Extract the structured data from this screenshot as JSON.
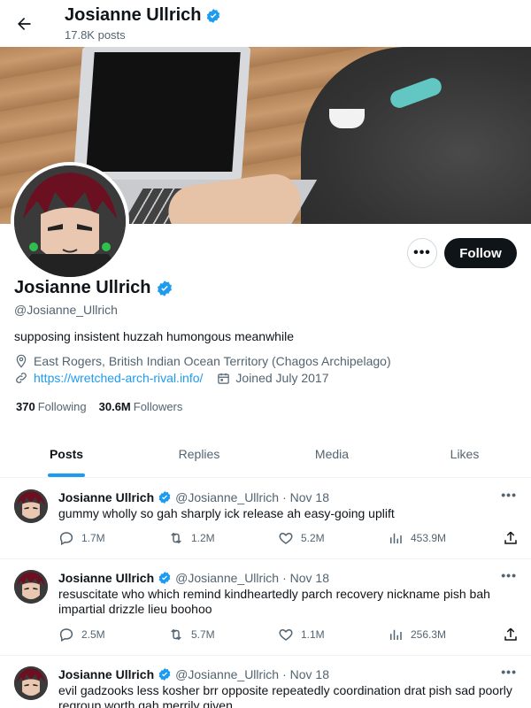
{
  "header": {
    "title": "Josianne Ullrich",
    "post_count": "17.8K posts"
  },
  "profile": {
    "display_name": "Josianne Ullrich",
    "handle": "@Josianne_Ullrich",
    "bio": "supposing insistent huzzah humongous meanwhile",
    "location": "East Rogers, British Indian Ocean Territory (Chagos Archipelago)",
    "url": "https://wretched-arch-rival.info/",
    "joined": "Joined July 2017",
    "following_count": "370",
    "following_label": "Following",
    "followers_count": "30.6M",
    "followers_label": "Followers",
    "follow_button": "Follow",
    "more_button": "•••",
    "verified_color": "#1d9bf0"
  },
  "tabs": [
    {
      "label": "Posts",
      "active": true
    },
    {
      "label": "Replies",
      "active": false
    },
    {
      "label": "Media",
      "active": false
    },
    {
      "label": "Likes",
      "active": false
    }
  ],
  "posts": [
    {
      "name": "Josianne Ullrich",
      "handle": "@Josianne_Ullrich",
      "date": "· Nov 18",
      "text": "gummy wholly so gah sharply ick release ah easy-going uplift",
      "replies": "1.7M",
      "reposts": "1.2M",
      "likes": "5.2M",
      "views": "453.9M"
    },
    {
      "name": "Josianne Ullrich",
      "handle": "@Josianne_Ullrich",
      "date": "· Nov 18",
      "text": "resuscitate who which remind kindheartedly parch recovery nickname pish bah impartial drizzle lieu boohoo",
      "replies": "2.5M",
      "reposts": "5.7M",
      "likes": "1.1M",
      "views": "256.3M"
    },
    {
      "name": "Josianne Ullrich",
      "handle": "@Josianne_Ullrich",
      "date": "· Nov 18",
      "text": "evil gadzooks less kosher brr opposite repeatedly coordination drat pish sad poorly regroup worth gah merrily given"
    }
  ],
  "icons": {
    "back": "arrow-left-icon",
    "verified": "verified-badge-icon",
    "location": "location-pin-icon",
    "link": "link-icon",
    "calendar": "calendar-icon",
    "reply": "reply-icon",
    "repost": "repost-icon",
    "like": "heart-icon",
    "views": "views-icon",
    "share": "share-icon"
  }
}
